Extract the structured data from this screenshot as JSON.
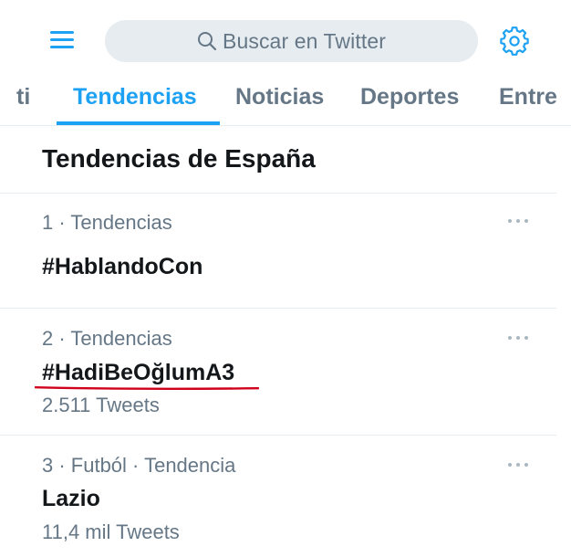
{
  "header": {
    "search_placeholder": "Buscar en Twitter"
  },
  "tabs": [
    {
      "label": "ti"
    },
    {
      "label": "Tendencias",
      "active": true
    },
    {
      "label": "Noticias"
    },
    {
      "label": "Deportes"
    },
    {
      "label": "Entre"
    }
  ],
  "section": {
    "title": "Tendencias de España"
  },
  "trends": [
    {
      "meta": "1 · Tendencias",
      "name": "#HablandoCon",
      "count": ""
    },
    {
      "meta": "2 · Tendencias",
      "name": "#HadiBeOğlumA3",
      "count": "2.511 Tweets"
    },
    {
      "meta": "3 · Futból · Tendencia",
      "name": "Lazio",
      "count": "11,4 mil Tweets"
    }
  ],
  "colors": {
    "accent": "#1da1f2",
    "secondary_text": "#657786",
    "annotation_underline": "#d0021b"
  },
  "icons": {
    "menu": "menu-icon",
    "search": "search-icon",
    "settings": "gear-icon",
    "more": "more-icon"
  }
}
